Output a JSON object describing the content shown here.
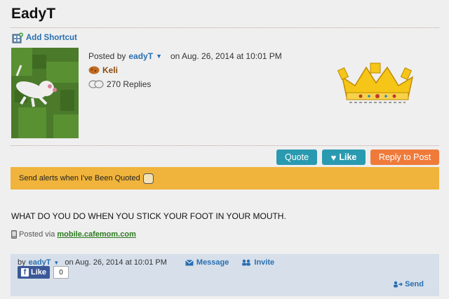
{
  "page": {
    "title": "EadyT"
  },
  "shortcut": {
    "label": "Add Shortcut"
  },
  "post": {
    "posted_by_prefix": "Posted by",
    "author": "eadyT",
    "date": "on Aug. 26, 2014 at 10:01 PM",
    "badge_name": "Keli",
    "replies": "270 Replies",
    "body": "WHAT DO YOU DO WHEN YOU STICK YOUR FOOT IN YOUR MOUTH.",
    "posted_via_prefix": "Posted via",
    "posted_via_link": "mobile.cafemom.com"
  },
  "actions": {
    "quote": "Quote",
    "like": "Like",
    "reply": "Reply to Post"
  },
  "alert": {
    "label": "Send alerts when I've Been Quoted"
  },
  "footer": {
    "by_prefix": "by",
    "author": "eadyT",
    "date": "on Aug. 26, 2014 at 10:01 PM",
    "message": "Message",
    "invite": "Invite",
    "fb_like": "Like",
    "fb_count": "0",
    "send": "Send"
  },
  "colors": {
    "link": "#2a6fb0",
    "teal_button": "#2a9ab0",
    "orange_button": "#ef7a3a",
    "alert_bar": "#f0b43c",
    "footer_bg": "#d6dfea",
    "facebook": "#3b5998"
  },
  "icons": [
    "add-shortcut-icon",
    "dropdown-arrow-icon",
    "cookie-badge-icon",
    "replies-bubbles-icon",
    "crown-icon",
    "heart-icon",
    "phone-icon",
    "envelope-icon",
    "people-icon",
    "facebook-icon",
    "send-people-icon"
  ]
}
